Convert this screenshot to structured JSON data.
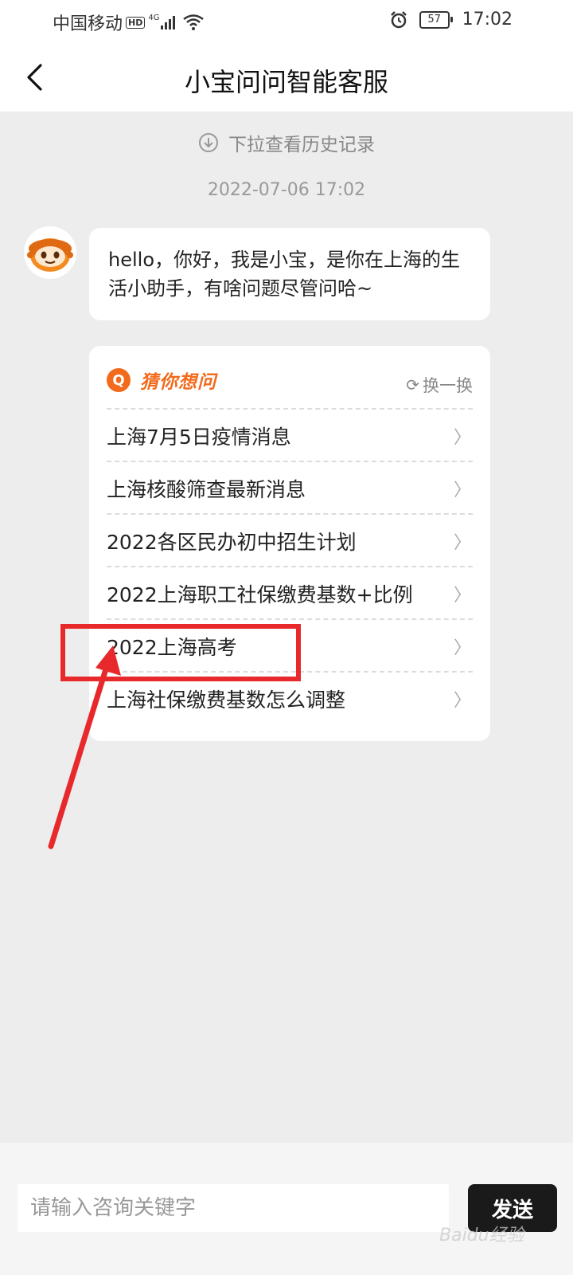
{
  "status_bar": {
    "carrier": "中国移动",
    "hd": "HD",
    "network": "4G",
    "battery": "57",
    "time": "17:02"
  },
  "header": {
    "title": "小宝问问智能客服"
  },
  "chat": {
    "history_hint": "下拉查看历史记录",
    "timestamp": "2022-07-06 17:02",
    "greeting": "hello，你好，我是小宝，是你在上海的生活小助手，有啥问题尽管问哈~"
  },
  "suggestions": {
    "badge": "Q",
    "title": "猜你想问",
    "refresh_label": "换一换",
    "items": [
      "上海7月5日疫情消息",
      "上海核酸筛查最新消息",
      "2022各区民办初中招生计划",
      "2022上海职工社保缴费基数+比例",
      "2022上海高考",
      "上海社保缴费基数怎么调整"
    ]
  },
  "input": {
    "placeholder": "请输入咨询关键字",
    "send_label": "发送"
  },
  "watermark": "Baidu经验",
  "colors": {
    "accent": "#f26b1d",
    "annotation": "#e8292b",
    "send_bg": "#1a1a1a"
  }
}
